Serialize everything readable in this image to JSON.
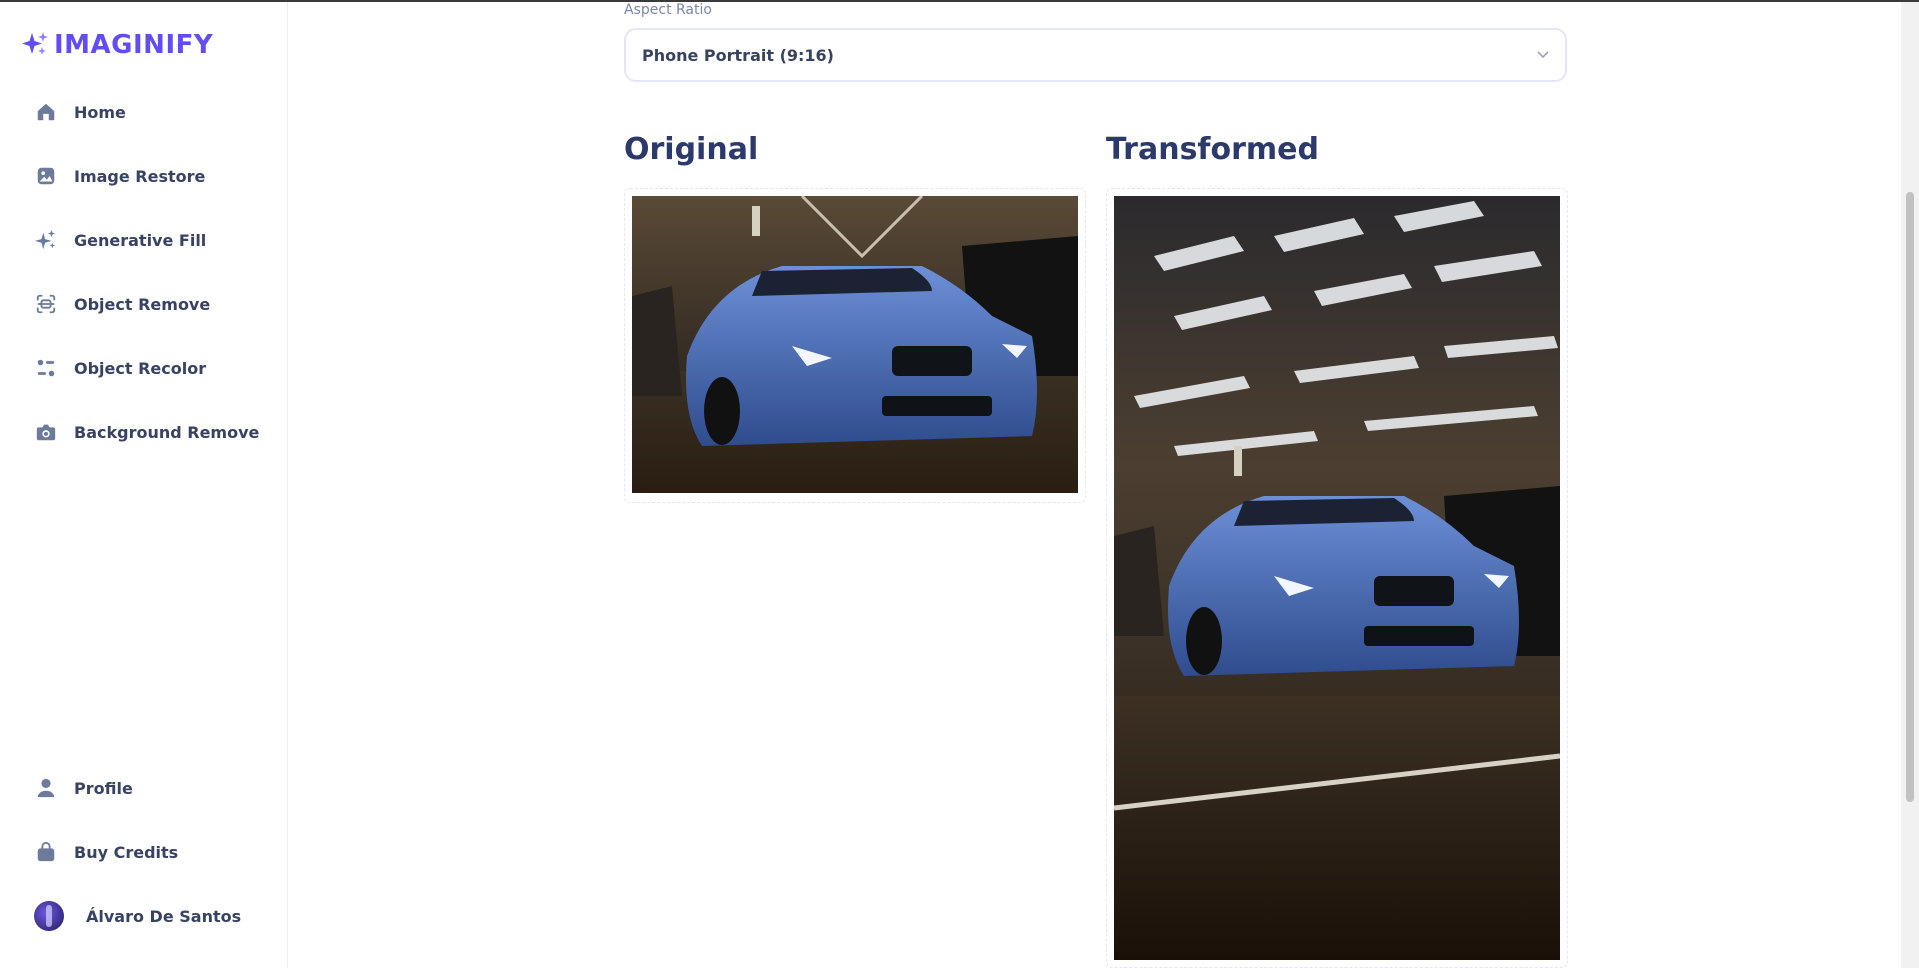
{
  "app": {
    "logo_text": "IMAGINIFY"
  },
  "sidebar": {
    "items": [
      {
        "label": "Home",
        "icon": "home-icon"
      },
      {
        "label": "Image Restore",
        "icon": "image-icon"
      },
      {
        "label": "Generative Fill",
        "icon": "sparkles-icon"
      },
      {
        "label": "Object Remove",
        "icon": "scan-icon"
      },
      {
        "label": "Object Recolor",
        "icon": "filter-icon"
      },
      {
        "label": "Background Remove",
        "icon": "camera-icon"
      }
    ],
    "bottom_items": [
      {
        "label": "Profile",
        "icon": "user-icon"
      },
      {
        "label": "Buy Credits",
        "icon": "bag-icon"
      }
    ],
    "user": {
      "name": "Álvaro De Santos"
    }
  },
  "form": {
    "aspect_ratio_label": "Aspect Ratio",
    "aspect_ratio_value": "Phone Portrait (9:16)"
  },
  "panels": {
    "original_title": "Original",
    "transformed_title": "Transformed"
  },
  "colors": {
    "brand": "#624cf5",
    "text": "#384262",
    "title": "#2b3a6b",
    "icon": "#6c7a9c"
  }
}
